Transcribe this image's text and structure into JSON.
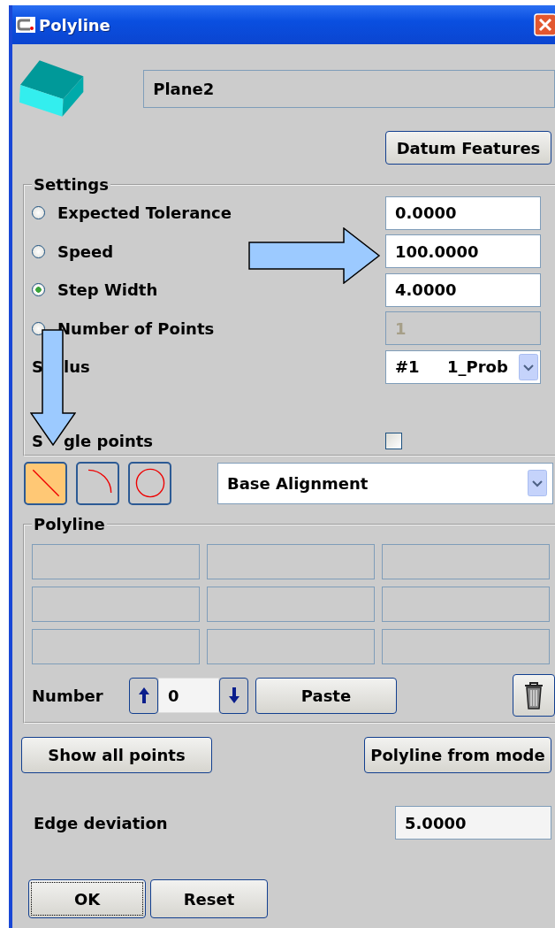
{
  "window": {
    "title": "Polyline"
  },
  "element_name": "Plane2",
  "datum_button": "Datum Features",
  "settings": {
    "title": "Settings",
    "options": [
      {
        "label": "Expected Tolerance",
        "selected": false,
        "value": "0.0000",
        "disabled": false
      },
      {
        "label": "Speed",
        "selected": false,
        "value": "100.0000",
        "disabled": false
      },
      {
        "label": "Step Width",
        "selected": true,
        "value": "4.0000",
        "disabled": false
      },
      {
        "label": "Number of Points",
        "selected": false,
        "value": "1",
        "disabled": true
      }
    ],
    "stylus": {
      "label_parts": [
        "S",
        "lus"
      ],
      "value": "#1     1_Prob"
    },
    "single_points": {
      "label_parts": [
        "S",
        "gle points"
      ],
      "checked": false
    }
  },
  "shape_tools": [
    {
      "kind": "line",
      "selected": true
    },
    {
      "kind": "arc",
      "selected": false
    },
    {
      "kind": "circle",
      "selected": false
    }
  ],
  "alignment": {
    "value": "Base Alignment"
  },
  "polyline": {
    "title": "Polyline",
    "point_fields": [
      {
        "disabled": true
      },
      {
        "disabled": true
      },
      {
        "disabled": true
      },
      {
        "disabled": true
      },
      {
        "disabled": true
      },
      {
        "disabled": true
      },
      {
        "disabled": true
      },
      {
        "disabled": true
      },
      {
        "disabled": true
      }
    ],
    "number_label": "Number",
    "number_value": "0",
    "paste_button": "Paste"
  },
  "show_all_button": "Show all points",
  "from_model_button": "Polyline from mode",
  "edge_deviation": {
    "label": "Edge deviation",
    "value": "5.0000"
  },
  "buttons": [
    {
      "label": "OK",
      "focused": true
    },
    {
      "label": "Reset",
      "focused": false
    }
  ]
}
